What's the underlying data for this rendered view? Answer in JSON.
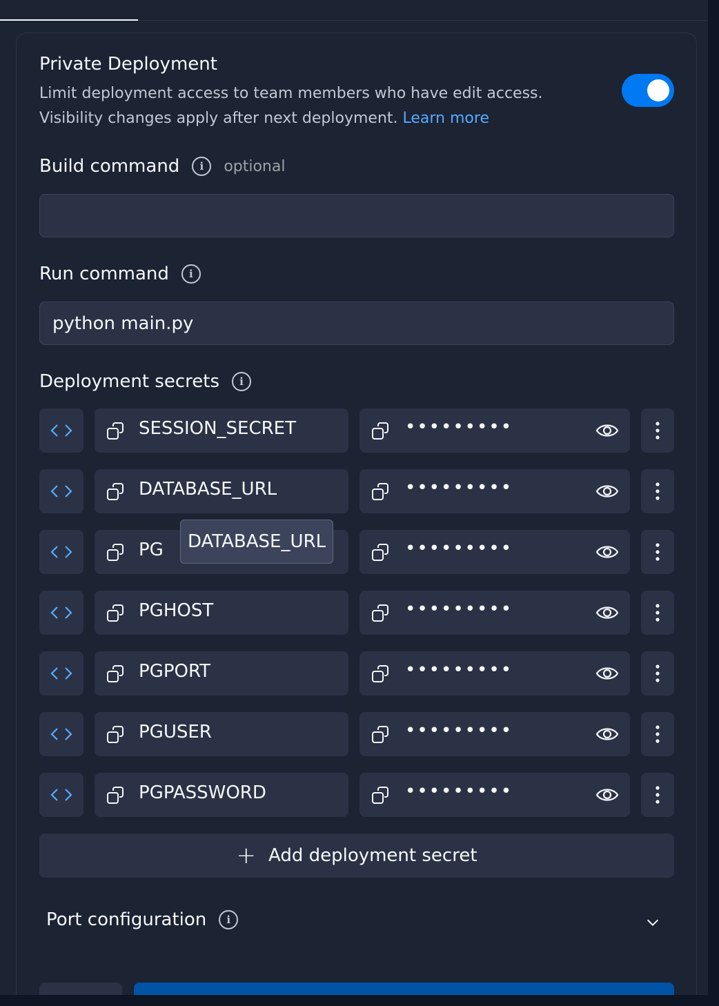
{
  "private_deployment": {
    "title": "Private Deployment",
    "description": "Limit deployment access to team members who have edit access. Visibility changes apply after next deployment.",
    "link_text": "Learn more",
    "toggle_on": true
  },
  "build_command": {
    "label": "Build command",
    "optional_text": "optional",
    "value": ""
  },
  "run_command": {
    "label": "Run command",
    "value": "python main.py"
  },
  "secrets": {
    "label": "Deployment secrets",
    "masked_value": "•••••••••",
    "items": [
      {
        "key": "SESSION_SECRET"
      },
      {
        "key": "DATABASE_URL"
      },
      {
        "key": "PG"
      },
      {
        "key": "PGHOST"
      },
      {
        "key": "PGPORT"
      },
      {
        "key": "PGUSER"
      },
      {
        "key": "PGPASSWORD"
      }
    ],
    "tooltip": "DATABASE_URL",
    "add_label": "Add deployment secret"
  },
  "port_config": {
    "label": "Port configuration"
  },
  "colors": {
    "background": "#1c2333",
    "surface": "#2b3245",
    "accent": "#0079f2",
    "link": "#57abff"
  }
}
